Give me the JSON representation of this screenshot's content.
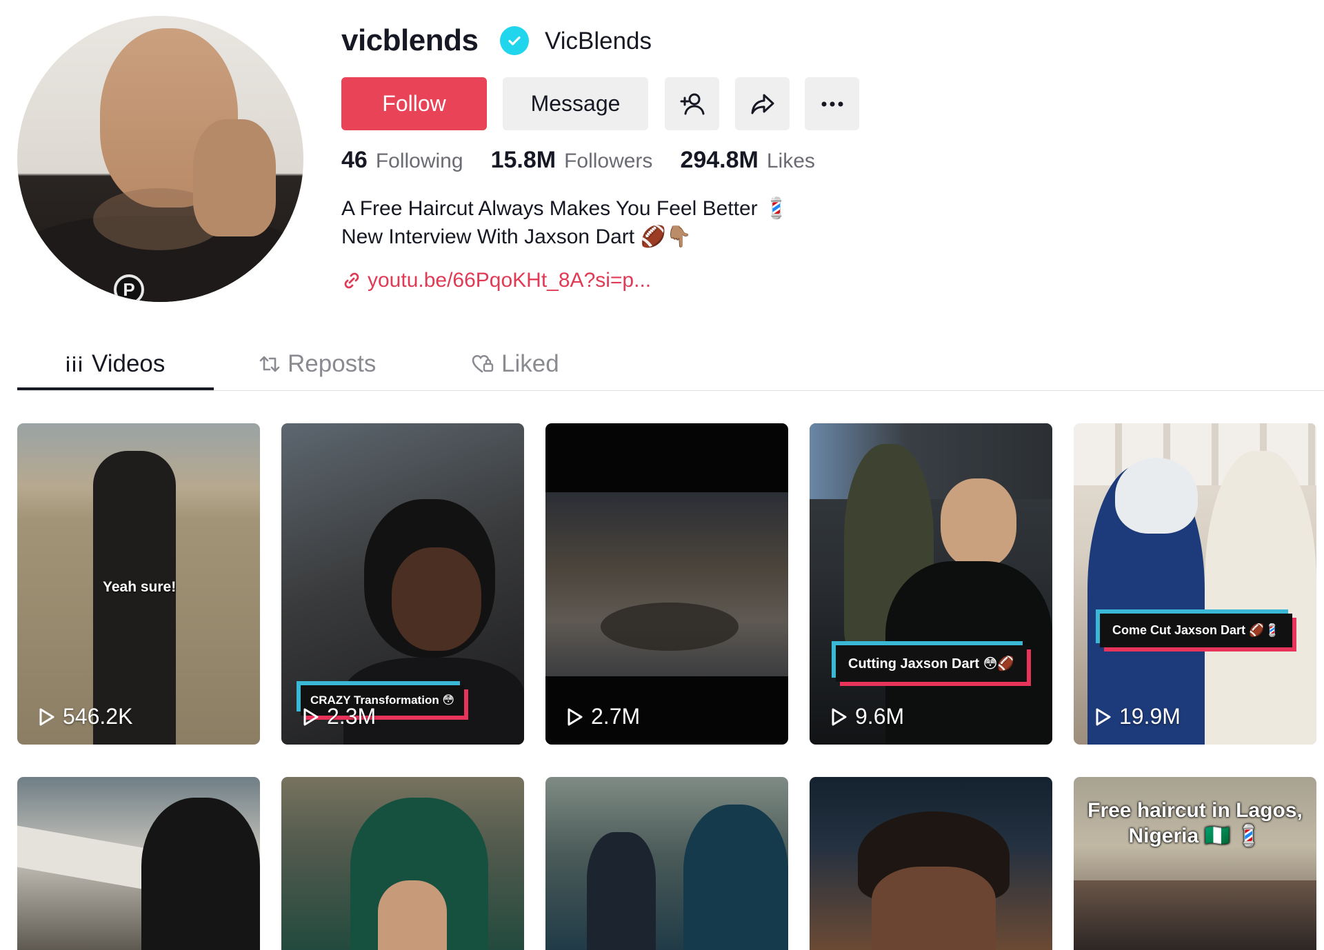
{
  "profile": {
    "username": "vicblends",
    "display_name": "VicBlends",
    "verified": true,
    "follow_label": "Follow",
    "message_label": "Message",
    "stats": {
      "following_count": "46",
      "following_label": "Following",
      "followers_count": "15.8M",
      "followers_label": "Followers",
      "likes_count": "294.8M",
      "likes_label": "Likes"
    },
    "bio_line1": "A Free Haircut Always Makes You Feel Better 💈",
    "bio_line2": "New Interview With Jaxson Dart 🏈👇🏽",
    "link": "youtu.be/66PqoKHt_8A?si=p..."
  },
  "tabs": [
    {
      "label": "Videos",
      "icon": "grid-icon",
      "active": true
    },
    {
      "label": "Reposts",
      "icon": "repost-icon",
      "active": false
    },
    {
      "label": "Liked",
      "icon": "heart-icon",
      "active": false
    }
  ],
  "videos": [
    {
      "views": "546.2K",
      "caption": "Yeah sure!"
    },
    {
      "views": "2.3M",
      "caption": "CRAZY Transformation 😳"
    },
    {
      "views": "2.7M",
      "caption": ""
    },
    {
      "views": "9.6M",
      "caption": "Cutting Jaxson Dart 😳🏈"
    },
    {
      "views": "19.9M",
      "caption": "Come Cut Jaxson Dart 🏈💈"
    },
    {
      "views": "",
      "caption": ""
    },
    {
      "views": "",
      "caption": ""
    },
    {
      "views": "",
      "caption": ""
    },
    {
      "views": "",
      "caption": ""
    },
    {
      "views": "",
      "caption": "Free haircut in Lagos, Nigeria 🇳🇬 💈"
    }
  ],
  "colors": {
    "follow_button": "#e84357",
    "link": "#e03a55",
    "verified": "#20d5ec",
    "caption_border_cyan": "#3ab8d6",
    "caption_border_red": "#e8345a"
  }
}
